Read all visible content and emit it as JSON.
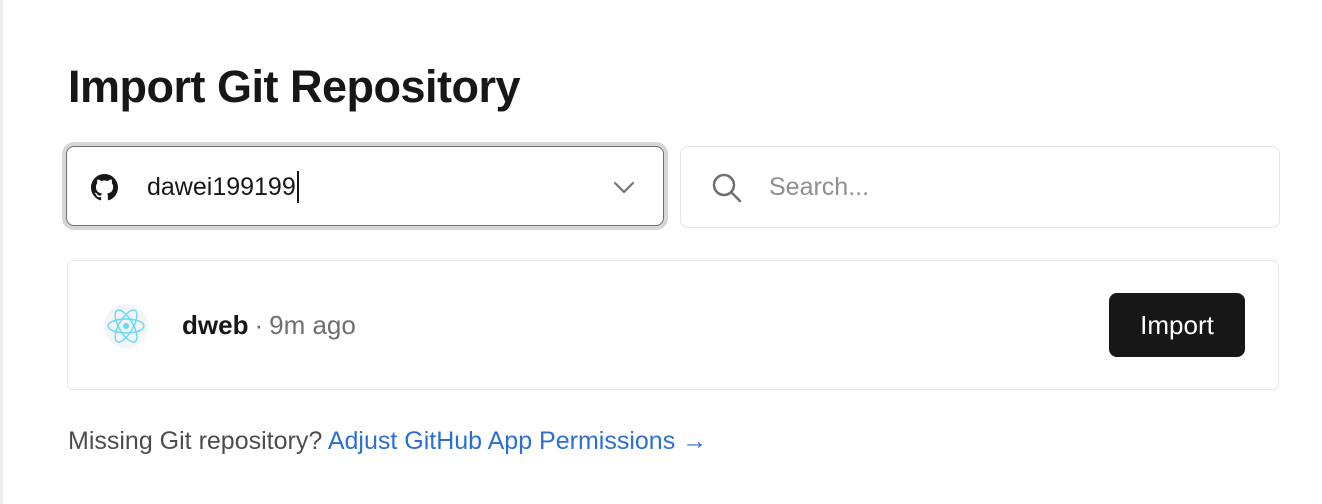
{
  "page": {
    "title": "Import Git Repository"
  },
  "account_select": {
    "icon": "github-icon",
    "value": "dawei199199",
    "dropdown_icon": "chevron-down-icon"
  },
  "search": {
    "icon": "search-icon",
    "placeholder": "Search..."
  },
  "repositories": [
    {
      "icon": "react-icon",
      "name": "dweb",
      "separator": "·",
      "updated": "9m ago",
      "action_label": "Import"
    }
  ],
  "footer": {
    "prompt": "Missing Git repository?",
    "link_label": "Adjust GitHub App Permissions →"
  },
  "colors": {
    "button_bg": "#171717",
    "link": "#2b6fd6",
    "react_accent": "#61dafb"
  }
}
